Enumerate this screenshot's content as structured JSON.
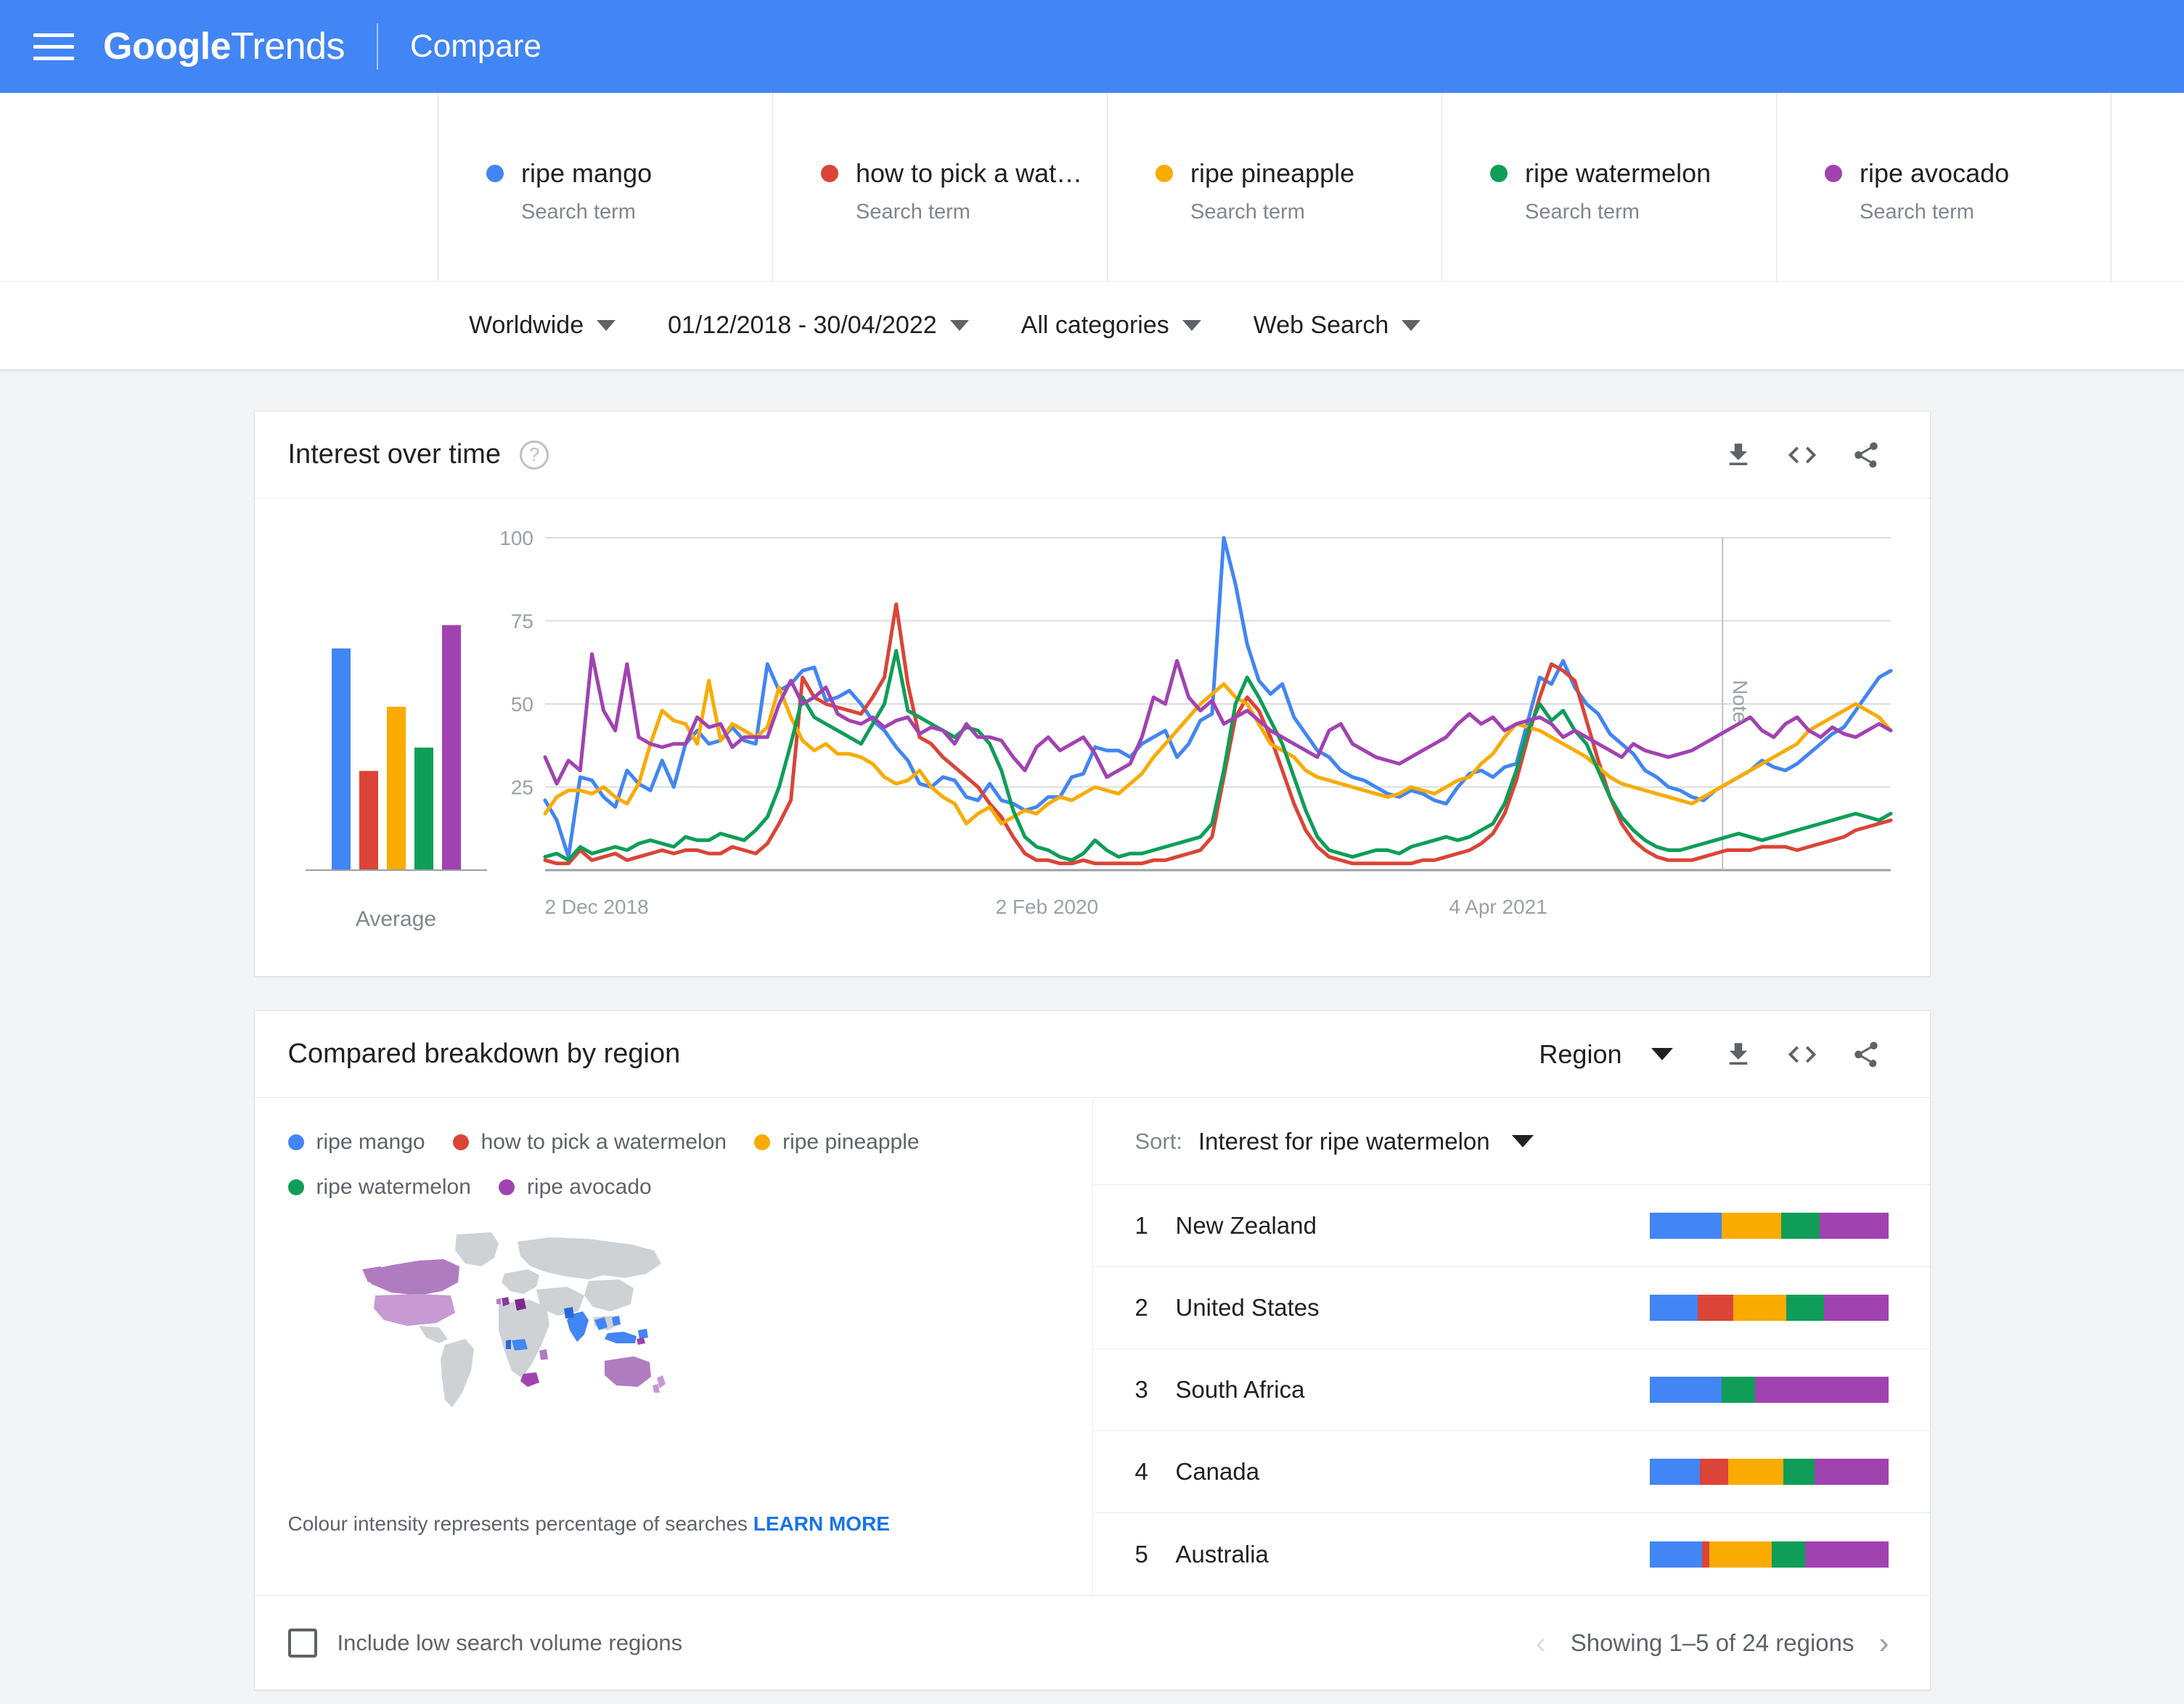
{
  "header": {
    "menu_icon": "hamburger-icon",
    "brand_google": "Google",
    "brand_trends": "Trends",
    "page_title": "Compare"
  },
  "terms": [
    {
      "label": "ripe mango",
      "type": "Search term",
      "color": "#4285f4"
    },
    {
      "label": "how to pick a water ...",
      "type": "Search term",
      "color": "#db4437"
    },
    {
      "label": "ripe pineapple",
      "type": "Search term",
      "color": "#f9ab00"
    },
    {
      "label": "ripe watermelon",
      "type": "Search term",
      "color": "#0f9d58"
    },
    {
      "label": "ripe avocado",
      "type": "Search term",
      "color": "#a142b1"
    }
  ],
  "filters": [
    {
      "label": "Worldwide",
      "name": "location-filter"
    },
    {
      "label": "01/12/2018 - 30/04/2022",
      "name": "date-filter"
    },
    {
      "label": "All categories",
      "name": "category-filter"
    },
    {
      "label": "Web Search",
      "name": "search-type-filter"
    }
  ],
  "interest_card": {
    "title": "Interest over time",
    "help": "?",
    "download_icon": "download-icon",
    "embed_icon": "embed-code-icon",
    "share_icon": "share-icon",
    "average_label": "Average",
    "note_label": "Note"
  },
  "region_card": {
    "title": "Compared breakdown by region",
    "region_select": "Region",
    "download_icon": "download-icon",
    "embed_icon": "embed-code-icon",
    "share_icon": "share-icon",
    "sort_label": "Sort:",
    "sort_value": "Interest for ripe watermelon",
    "map_note_text": "Colour intensity represents percentage of searches",
    "map_note_link": "LEARN MORE",
    "include_low_volume": "Include low search volume regions",
    "pagination_text": "Showing 1–5 of 24 regions",
    "prev_arrow": "‹",
    "next_arrow": "›",
    "legend": [
      {
        "label": "ripe mango",
        "color": "#4285f4"
      },
      {
        "label": "how to pick a watermelon",
        "color": "#db4437"
      },
      {
        "label": "ripe pineapple",
        "color": "#f9ab00"
      },
      {
        "label": "ripe watermelon",
        "color": "#0f9d58"
      },
      {
        "label": "ripe avocado",
        "color": "#a142b1"
      }
    ],
    "rows": [
      {
        "rank": "1",
        "name": "New Zealand",
        "segments": [
          30,
          0,
          25,
          16,
          29
        ]
      },
      {
        "rank": "2",
        "name": "United States",
        "segments": [
          20,
          15,
          22,
          16,
          27
        ]
      },
      {
        "rank": "3",
        "name": "South Africa",
        "segments": [
          30,
          0,
          0,
          14,
          56
        ]
      },
      {
        "rank": "4",
        "name": "Canada",
        "segments": [
          21,
          12,
          23,
          13,
          31
        ]
      },
      {
        "rank": "5",
        "name": "Australia",
        "segments": [
          22,
          3,
          26,
          14,
          35
        ]
      }
    ]
  },
  "chart_data": {
    "type": "line",
    "title": "Interest over time",
    "xlabel": "",
    "ylabel": "",
    "ylim": [
      0,
      100
    ],
    "yticks": [
      25,
      50,
      75,
      100
    ],
    "grid": true,
    "xticks": [
      "2 Dec 2018",
      "2 Feb 2020",
      "4 Apr 2021"
    ],
    "xtick_positions": [
      0.0,
      0.335,
      0.672
    ],
    "annotations": [
      {
        "label": "Note",
        "x": 0.875
      }
    ],
    "series": [
      {
        "name": "ripe mango",
        "color": "#4285f4",
        "average": 38,
        "values": [
          21,
          15,
          4,
          28,
          27,
          22,
          19,
          30,
          26,
          24,
          33,
          25,
          38,
          42,
          38,
          39,
          43,
          39,
          38,
          62,
          54,
          56,
          60,
          61,
          51,
          52,
          54,
          50,
          45,
          42,
          37,
          33,
          26,
          25,
          28,
          27,
          22,
          21,
          26,
          21,
          20,
          18,
          19,
          22,
          22,
          28,
          29,
          37,
          36,
          36,
          34,
          38,
          40,
          42,
          34,
          38,
          45,
          47,
          100,
          86,
          68,
          57,
          53,
          56,
          46,
          41,
          36,
          34,
          30,
          28,
          27,
          25,
          23,
          22,
          24,
          23,
          21,
          20,
          25,
          29,
          30,
          28,
          31,
          32,
          45,
          58,
          56,
          63,
          55,
          50,
          47,
          41,
          38,
          35,
          30,
          28,
          25,
          24,
          22,
          21,
          24,
          26,
          28,
          30,
          33,
          31,
          30,
          32,
          35,
          38,
          41,
          43,
          48,
          53,
          58,
          60
        ]
      },
      {
        "name": "how to pick a watermelon",
        "color": "#db4437",
        "average": 17,
        "values": [
          3,
          2,
          2,
          6,
          3,
          4,
          5,
          3,
          4,
          5,
          6,
          5,
          6,
          6,
          5,
          5,
          7,
          6,
          5,
          8,
          14,
          21,
          58,
          52,
          50,
          49,
          48,
          47,
          52,
          58,
          80,
          56,
          40,
          38,
          34,
          31,
          28,
          25,
          20,
          16,
          10,
          5,
          3,
          3,
          2,
          2,
          3,
          2,
          2,
          2,
          2,
          2,
          3,
          3,
          4,
          5,
          6,
          10,
          28,
          46,
          52,
          48,
          40,
          30,
          20,
          12,
          7,
          4,
          3,
          2,
          2,
          2,
          2,
          2,
          2,
          3,
          3,
          4,
          5,
          6,
          8,
          11,
          17,
          27,
          40,
          52,
          62,
          60,
          57,
          45,
          33,
          22,
          14,
          9,
          6,
          4,
          3,
          3,
          3,
          4,
          5,
          6,
          6,
          6,
          7,
          7,
          7,
          6,
          7,
          8,
          9,
          10,
          12,
          13,
          14,
          15
        ]
      },
      {
        "name": "ripe pineapple",
        "color": "#f9ab00",
        "average": 28,
        "values": [
          17,
          22,
          24,
          24,
          23,
          25,
          22,
          20,
          26,
          38,
          48,
          45,
          44,
          38,
          57,
          39,
          44,
          42,
          40,
          43,
          55,
          46,
          39,
          36,
          38,
          35,
          35,
          34,
          32,
          28,
          26,
          27,
          30,
          25,
          22,
          20,
          14,
          17,
          19,
          14,
          16,
          18,
          17,
          20,
          22,
          21,
          23,
          25,
          24,
          23,
          26,
          29,
          34,
          38,
          42,
          46,
          50,
          53,
          56,
          52,
          50,
          44,
          38,
          36,
          34,
          30,
          28,
          27,
          26,
          25,
          24,
          23,
          22,
          23,
          25,
          24,
          23,
          25,
          27,
          28,
          32,
          35,
          40,
          44,
          43,
          42,
          40,
          38,
          36,
          34,
          31,
          28,
          26,
          25,
          24,
          23,
          22,
          21,
          20,
          22,
          24,
          26,
          28,
          30,
          32,
          34,
          36,
          38,
          42,
          44,
          46,
          48,
          50,
          48,
          46,
          42
        ]
      },
      {
        "name": "ripe watermelon",
        "color": "#0f9d58",
        "average": 21,
        "values": [
          4,
          5,
          3,
          7,
          5,
          6,
          7,
          6,
          8,
          9,
          8,
          7,
          10,
          9,
          9,
          11,
          10,
          9,
          12,
          16,
          25,
          38,
          52,
          46,
          44,
          42,
          40,
          38,
          44,
          50,
          66,
          48,
          46,
          44,
          42,
          40,
          43,
          42,
          38,
          30,
          18,
          10,
          7,
          6,
          4,
          3,
          5,
          9,
          6,
          4,
          5,
          5,
          6,
          7,
          8,
          9,
          10,
          14,
          30,
          50,
          58,
          52,
          45,
          38,
          28,
          18,
          10,
          6,
          5,
          4,
          5,
          6,
          6,
          5,
          7,
          8,
          9,
          10,
          9,
          10,
          12,
          14,
          20,
          30,
          42,
          50,
          45,
          48,
          42,
          38,
          30,
          22,
          16,
          12,
          9,
          7,
          6,
          6,
          7,
          8,
          9,
          10,
          11,
          10,
          9,
          10,
          11,
          12,
          13,
          14,
          15,
          16,
          17,
          16,
          15,
          17
        ]
      },
      {
        "name": "ripe avocado",
        "color": "#a142b1",
        "average": 42,
        "values": [
          34,
          26,
          33,
          30,
          65,
          48,
          42,
          62,
          40,
          38,
          37,
          38,
          38,
          46,
          43,
          44,
          37,
          40,
          40,
          40,
          50,
          57,
          50,
          52,
          55,
          47,
          45,
          44,
          46,
          43,
          45,
          46,
          41,
          43,
          42,
          38,
          44,
          40,
          40,
          39,
          34,
          30,
          37,
          40,
          36,
          38,
          40,
          35,
          28,
          30,
          32,
          40,
          52,
          50,
          63,
          52,
          48,
          51,
          44,
          46,
          48,
          45,
          42,
          40,
          38,
          36,
          34,
          42,
          44,
          38,
          36,
          34,
          33,
          32,
          34,
          36,
          38,
          40,
          44,
          47,
          44,
          46,
          42,
          44,
          45,
          46,
          44,
          40,
          42,
          40,
          38,
          36,
          34,
          38,
          36,
          35,
          34,
          35,
          36,
          38,
          40,
          42,
          44,
          46,
          42,
          40,
          44,
          46,
          42,
          40,
          43,
          41,
          40,
          42,
          44,
          42
        ]
      }
    ],
    "average_bars": {
      "label": "Average",
      "categories": [
        "ripe mango",
        "how to pick a watermelon",
        "ripe pineapple",
        "ripe watermelon",
        "ripe avocado"
      ],
      "values": [
        38,
        17,
        28,
        21,
        42
      ],
      "colors": [
        "#4285f4",
        "#db4437",
        "#f9ab00",
        "#0f9d58",
        "#a142b1"
      ]
    }
  },
  "map": {
    "base_color": "#cfd2d4",
    "highlight_colors": [
      "#4285f4",
      "#a142b1"
    ]
  }
}
